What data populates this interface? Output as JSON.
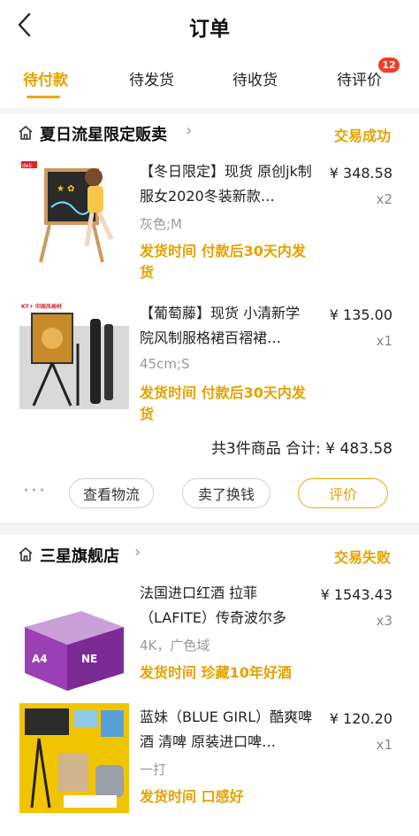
{
  "header": {
    "title": "订单"
  },
  "tabs": [
    {
      "label": "待付款",
      "active": true
    },
    {
      "label": "待发货",
      "active": false
    },
    {
      "label": "待收货",
      "active": false
    },
    {
      "label": "待评价",
      "active": false,
      "badge": "12"
    }
  ],
  "orders": [
    {
      "shop_name": "夏日流星限定贩卖",
      "status": "交易成功",
      "items": [
        {
          "title": "【冬日限定】现货 原创jk制服女2020冬装新款…",
          "price": "¥ 348.58",
          "qty": "x2",
          "spec": "灰色;M",
          "shipping": "发货时间 付款后30天内发货",
          "thumb_brand": "deli"
        },
        {
          "title": "【葡萄藤】现货 小清新学院风制服格裙百褶裙…",
          "price": "¥ 135.00",
          "qty": "x1",
          "spec": "45cm;S",
          "shipping": "发货时间 付款后30天内发货",
          "thumb_brand": "KT+ 中国风画材"
        }
      ],
      "summary": "共3件商品 合计: ¥ 483.58",
      "actions": {
        "more": "···",
        "logistics": "查看物流",
        "resell": "卖了换钱",
        "review": "评价"
      }
    },
    {
      "shop_name": "三星旗舰店",
      "status": "交易失败",
      "items": [
        {
          "title": "法国进口红酒 拉菲（LAFITE）传奇波尔多干…",
          "price": "¥ 1543.43",
          "qty": "x3",
          "spec": "4K，广色域",
          "shipping": "发货时间 珍藏10年好酒"
        },
        {
          "title": "蓝妹（BLUE GIRL）酷爽啤酒 清啤 原装进口啤…",
          "price": "¥ 120.20",
          "qty": "x1",
          "spec": "一打",
          "shipping": "发货时间 口感好"
        }
      ]
    }
  ],
  "colors": {
    "accent": "#f0a500",
    "accent_text": "#e6a100",
    "badge": "#f03c2e",
    "background": "#f4f4f4"
  }
}
